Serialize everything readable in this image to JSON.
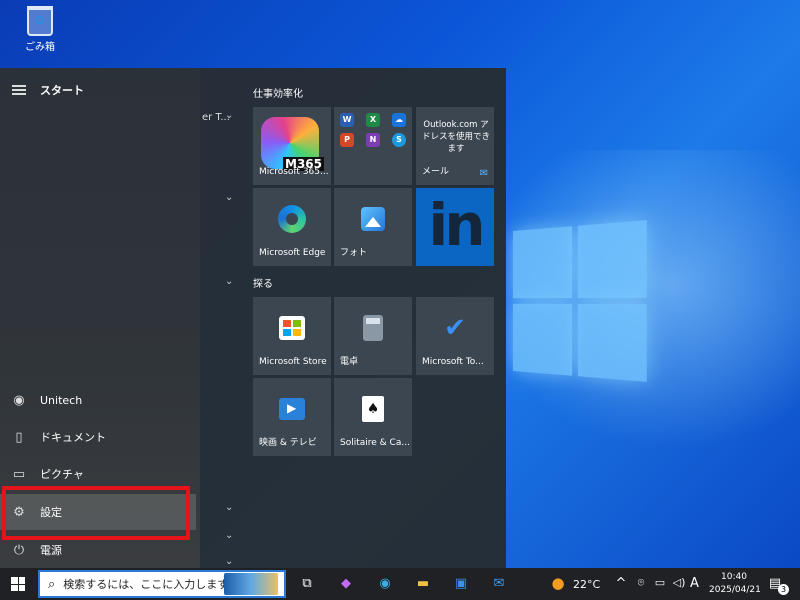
{
  "desktop": {
    "recycle_bin_label": "ごみ箱"
  },
  "start_menu": {
    "title": "スタート",
    "rail_items": [
      {
        "label": "Unitech",
        "icon": "user-icon"
      },
      {
        "label": "ドキュメント",
        "icon": "document-icon"
      },
      {
        "label": "ピクチャ",
        "icon": "pictures-icon"
      },
      {
        "label": "設定",
        "icon": "gear-icon"
      },
      {
        "label": "電源",
        "icon": "power-icon"
      }
    ],
    "app_list_fragment": "er T...",
    "groups": [
      {
        "label": "仕事効率化",
        "tiles": [
          {
            "label": "Microsoft 365...",
            "badge": "M365"
          },
          {
            "label": "",
            "sub": "office-apps"
          },
          {
            "label": "メール",
            "text": "Outlook.com アドレスを使用できます"
          },
          {
            "label": "Microsoft Edge"
          },
          {
            "label": "フォト"
          },
          {
            "label": "",
            "logo_text": "in"
          }
        ]
      },
      {
        "label": "探る",
        "tiles": [
          {
            "label": "Microsoft Store"
          },
          {
            "label": "電卓"
          },
          {
            "label": "Microsoft To..."
          },
          {
            "label": "映画 & テレビ"
          },
          {
            "label": "Solitaire & Ca..."
          }
        ]
      }
    ],
    "office_icons": [
      "W",
      "X",
      "☁",
      "P",
      "N",
      "S"
    ]
  },
  "taskbar": {
    "search_placeholder": "検索するには、ここに入力します",
    "weather_temp": "22°C",
    "ime": "A",
    "time": "10:40",
    "date": "2025/04/21",
    "notification_count": "3"
  },
  "colors": {
    "highlight": "#e5141a",
    "linkedin": "#0a66c2",
    "desktop_blue": "#0b57d8"
  }
}
